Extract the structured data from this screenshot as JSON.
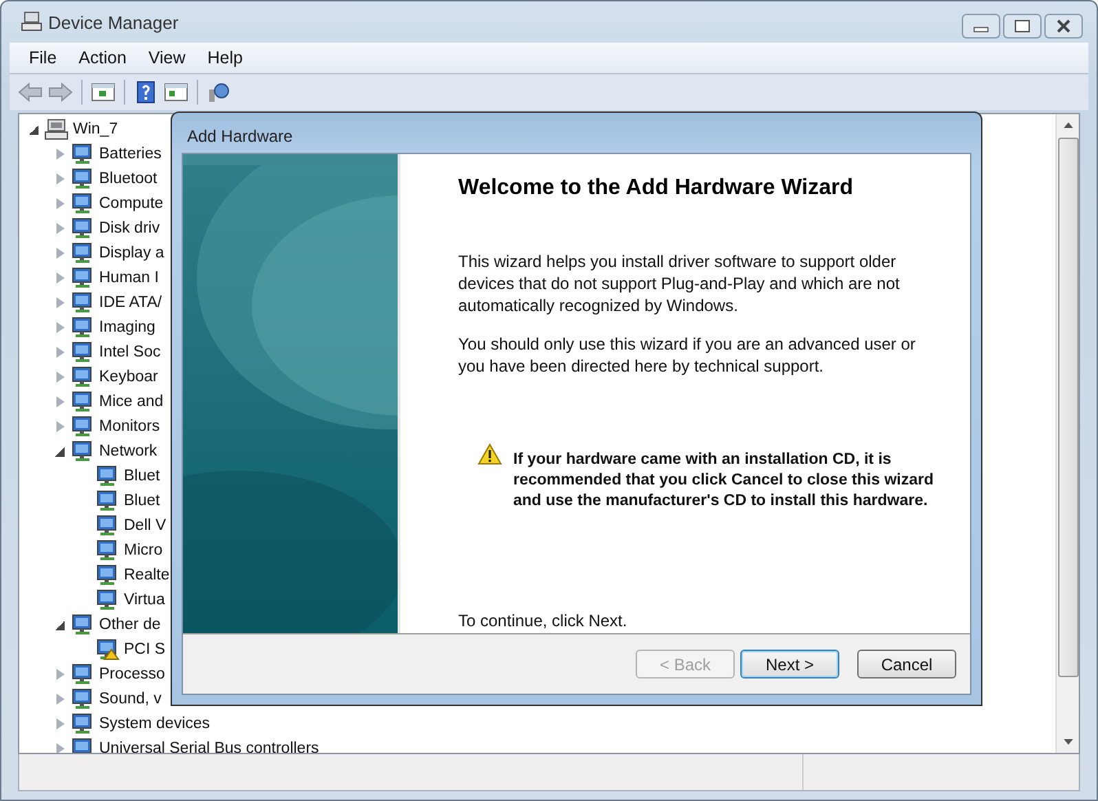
{
  "window": {
    "title": "Device Manager"
  },
  "menu": [
    "File",
    "Action",
    "View",
    "Help"
  ],
  "tree": [
    {
      "label": "Win_7",
      "expanded": true,
      "children": [
        {
          "label": "Batteries",
          "expanded": false
        },
        {
          "label": "Bluetoot",
          "expanded": false
        },
        {
          "label": "Compute",
          "expanded": false
        },
        {
          "label": "Disk driv",
          "expanded": false
        },
        {
          "label": "Display a",
          "expanded": false
        },
        {
          "label": "Human I",
          "expanded": false
        },
        {
          "label": "IDE ATA/",
          "expanded": false
        },
        {
          "label": "Imaging",
          "expanded": false
        },
        {
          "label": "Intel Soc",
          "expanded": false
        },
        {
          "label": "Keyboar",
          "expanded": false
        },
        {
          "label": "Mice and",
          "expanded": false
        },
        {
          "label": "Monitors",
          "expanded": false
        },
        {
          "label": "Network",
          "expanded": true,
          "children": [
            {
              "label": "Bluet"
            },
            {
              "label": "Bluet"
            },
            {
              "label": "Dell V"
            },
            {
              "label": "Micro"
            },
            {
              "label": "Realte"
            },
            {
              "label": "Virtua"
            }
          ]
        },
        {
          "label": "Other de",
          "expanded": true,
          "children": [
            {
              "label": "PCI S",
              "warning": true
            }
          ]
        },
        {
          "label": "Processo",
          "expanded": false
        },
        {
          "label": "Sound, v",
          "expanded": false
        },
        {
          "label": "System devices",
          "expanded": false
        },
        {
          "label": "Universal Serial Bus controllers",
          "expanded": false
        }
      ]
    }
  ],
  "dialog": {
    "title": "Add Hardware",
    "heading": "Welcome to the Add Hardware Wizard",
    "paragraphs": [
      "This wizard helps you install driver software to support older devices that do not support Plug-and-Play and which are not automatically recognized by Windows.",
      "You should only use this wizard if you are an advanced user or you have been directed here by technical support."
    ],
    "warning": "If your hardware came with an installation CD, it is recommended that you click Cancel to close this wizard and use the manufacturer's CD to install this hardware.",
    "footer_text": "To continue, click Next.",
    "buttons": [
      {
        "label": "< Back",
        "disabled": true,
        "default": false
      },
      {
        "label": "Next >",
        "disabled": false,
        "default": true
      },
      {
        "label": "Cancel",
        "disabled": false,
        "default": false
      }
    ]
  }
}
